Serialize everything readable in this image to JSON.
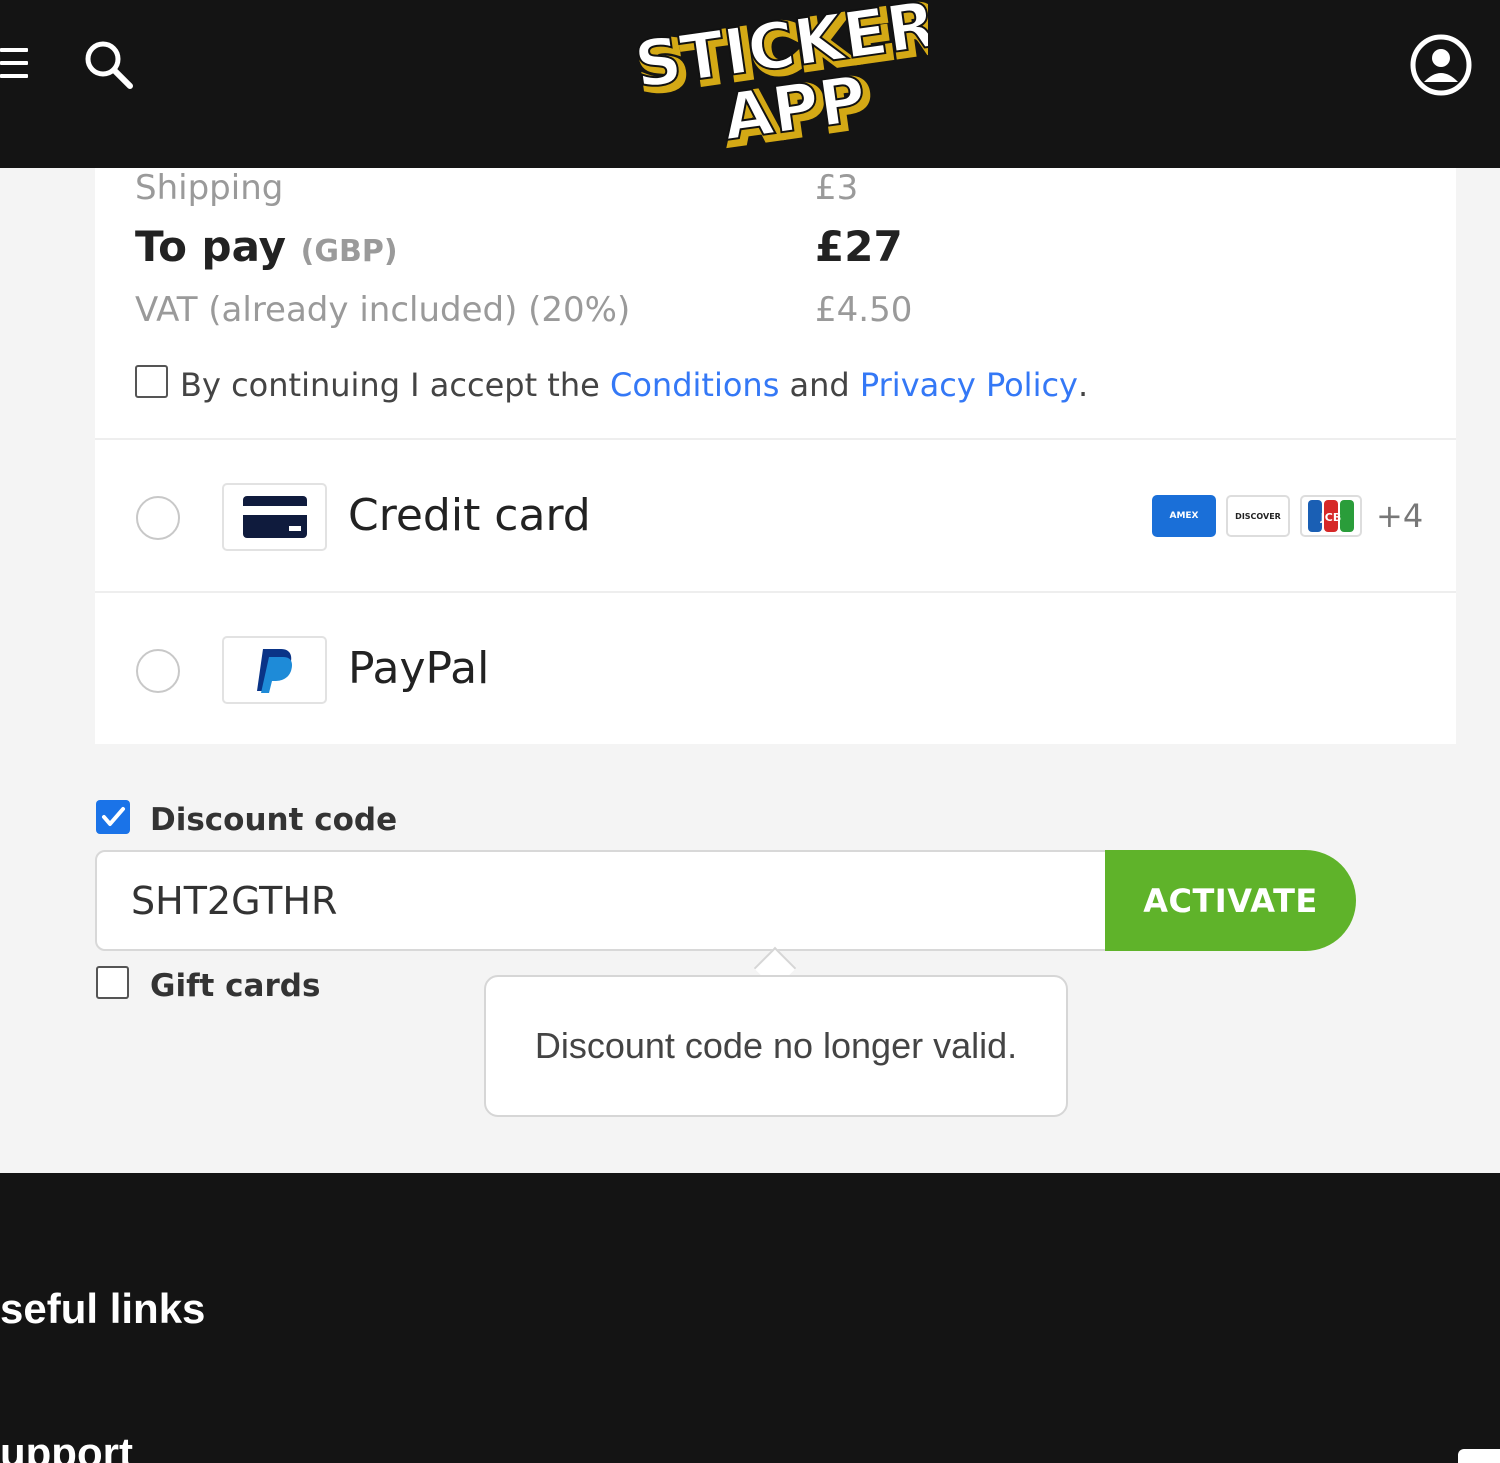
{
  "header": {
    "logo_line1": "STICKER",
    "logo_line2": "APP"
  },
  "summary": {
    "shipping_label": "Shipping",
    "shipping_value": "£3",
    "topay_label": "To pay",
    "topay_currency": "(GBP)",
    "topay_value": "£27",
    "vat_label": "VAT (already included) (20%)",
    "vat_value": "£4.50",
    "accept_prefix": "By continuing I accept the ",
    "accept_conditions": "Conditions",
    "accept_and": " and ",
    "accept_privacy": "Privacy Policy",
    "accept_suffix": "."
  },
  "payment": {
    "methods": [
      {
        "label": "Credit card",
        "icon": "credit-card-icon"
      },
      {
        "label": "PayPal",
        "icon": "paypal-icon"
      }
    ],
    "brands": [
      "AMEX",
      "DISCOVER",
      "JCB"
    ],
    "more_brands": "+4"
  },
  "discount": {
    "label": "Discount code",
    "checked": true,
    "value": "SHT2GTHR",
    "button": "ACTIVATE",
    "error": "Discount code no longer valid."
  },
  "gift": {
    "label": "Gift cards",
    "checked": false
  },
  "footer": {
    "heading": "seful links",
    "link": "upport"
  },
  "colors": {
    "header_bg": "#141414",
    "accent_green": "#5fb32a",
    "link_blue": "#3478f6",
    "check_blue": "#1a73e8"
  }
}
